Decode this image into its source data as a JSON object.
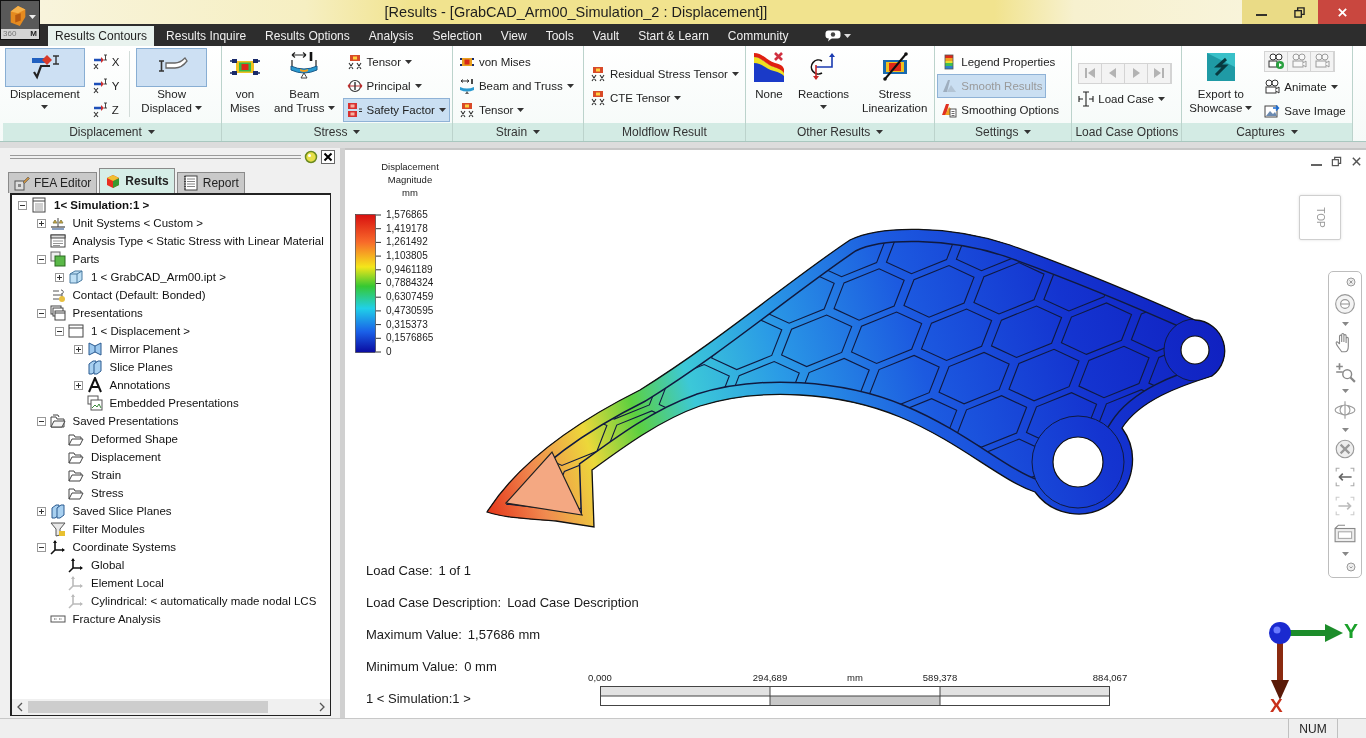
{
  "app_button": {
    "badge": "360",
    "letter": "M"
  },
  "window": {
    "title": "[Results - [GrabCAD_Arm00_Simulation_2 : Displacement]]"
  },
  "ribbon_tabs": [
    {
      "label": "Results Contours",
      "selected": true
    },
    {
      "label": "Results Inquire",
      "selected": false
    },
    {
      "label": "Results Options",
      "selected": false
    },
    {
      "label": "Analysis",
      "selected": false
    },
    {
      "label": "Selection",
      "selected": false
    },
    {
      "label": "View",
      "selected": false
    },
    {
      "label": "Tools",
      "selected": false
    },
    {
      "label": "Vault",
      "selected": false
    },
    {
      "label": "Start & Learn",
      "selected": false
    },
    {
      "label": "Community",
      "selected": false
    }
  ],
  "ribbon_groups": [
    {
      "label": "Displacement",
      "menu": true,
      "columns": [
        {
          "kind": "large",
          "items": [
            {
              "kind": "displacement",
              "lines": [
                "Displacement"
              ],
              "dropdown": true,
              "selected": true,
              "disabled": false
            }
          ]
        },
        {
          "kind": "small",
          "items": [
            {
              "kind": "axis",
              "label": "X",
              "dropdown": false,
              "selected": false,
              "disabled": false
            },
            {
              "kind": "axis",
              "label": "Y",
              "dropdown": false,
              "selected": false,
              "disabled": false
            },
            {
              "kind": "axis",
              "label": "Z",
              "dropdown": false,
              "selected": false,
              "disabled": false
            }
          ]
        },
        {
          "kind": "large",
          "items": [
            {
              "kind": "show_displaced",
              "lines": [
                "Show",
                "Displaced"
              ],
              "dropdown": true,
              "selected": true,
              "disabled": false
            }
          ]
        }
      ]
    },
    {
      "label": "Stress",
      "menu": true,
      "columns": [
        {
          "kind": "large",
          "items": [
            {
              "kind": "stress_block",
              "lines": [
                "von",
                "Mises"
              ],
              "dropdown": false,
              "selected": false,
              "disabled": false
            }
          ]
        },
        {
          "kind": "large",
          "items": [
            {
              "kind": "beam",
              "lines": [
                "Beam",
                "and Truss"
              ],
              "dropdown": true,
              "selected": false,
              "disabled": false
            }
          ]
        },
        {
          "kind": "small",
          "items": [
            {
              "kind": "tensor",
              "label": "Tensor",
              "dropdown": true,
              "selected": false,
              "disabled": false
            },
            {
              "kind": "principal",
              "label": "Principal",
              "dropdown": true,
              "selected": false,
              "disabled": false
            },
            {
              "kind": "safety",
              "label": "Safety Factor",
              "dropdown": true,
              "selected": true,
              "disabled": false
            }
          ]
        }
      ]
    },
    {
      "label": "Strain",
      "menu": true,
      "columns": [
        {
          "kind": "small",
          "items": [
            {
              "kind": "stress_small",
              "label": "von Mises",
              "dropdown": false,
              "selected": false,
              "disabled": false
            },
            {
              "kind": "beam_small",
              "label": "Beam and Truss",
              "dropdown": true,
              "selected": false,
              "disabled": false
            },
            {
              "kind": "tensor",
              "label": "Tensor",
              "dropdown": true,
              "selected": false,
              "disabled": false
            }
          ]
        }
      ]
    },
    {
      "label": "Moldflow Result",
      "menu": false,
      "columns": [
        {
          "kind": "small",
          "items": [
            {
              "kind": "tensor",
              "label": "Residual Stress Tensor",
              "dropdown": true,
              "selected": false,
              "disabled": false
            },
            {
              "kind": "tensor",
              "label": "CTE Tensor",
              "dropdown": true,
              "selected": false,
              "disabled": false
            }
          ]
        }
      ]
    },
    {
      "label": "Other Results",
      "menu": true,
      "columns": [
        {
          "kind": "large",
          "items": [
            {
              "kind": "contour_none",
              "lines": [
                "None"
              ],
              "dropdown": false,
              "selected": false,
              "disabled": false
            }
          ]
        },
        {
          "kind": "large",
          "items": [
            {
              "kind": "reactions",
              "lines": [
                "Reactions"
              ],
              "dropdown": true,
              "selected": false,
              "disabled": false
            }
          ]
        },
        {
          "kind": "large",
          "items": [
            {
              "kind": "linearization",
              "lines": [
                "Stress",
                "Linearization"
              ],
              "dropdown": false,
              "selected": false,
              "disabled": false
            }
          ]
        }
      ]
    },
    {
      "label": "Settings",
      "menu": true,
      "columns": [
        {
          "kind": "small",
          "items": [
            {
              "kind": "legend",
              "label": "Legend Properties",
              "dropdown": false,
              "selected": false,
              "disabled": false
            },
            {
              "kind": "smooth",
              "label": "Smooth Results",
              "dropdown": false,
              "selected": true,
              "disabled": true
            },
            {
              "kind": "smoothing",
              "label": "Smoothing Options",
              "dropdown": false,
              "selected": false,
              "disabled": false
            }
          ]
        }
      ]
    },
    {
      "label": "Load Case Options",
      "menu": false,
      "columns": [
        {
          "kind": "small",
          "items": [
            {
              "kind": "first",
              "selected": false,
              "disabled": true
            },
            {
              "kind": "previous",
              "selected": false,
              "disabled": true
            },
            {
              "kind": "next",
              "selected": false,
              "disabled": true
            },
            {
              "kind": "last",
              "selected": false,
              "disabled": true
            },
            {
              "kind": "load_case",
              "label": "Load Case",
              "dropdown": true,
              "selected": false,
              "disabled": false
            }
          ]
        }
      ]
    },
    {
      "label": "Captures",
      "menu": true,
      "columns": [
        {
          "kind": "large",
          "items": [
            {
              "kind": "showcase",
              "lines": [
                "Export to",
                "Showcase"
              ],
              "dropdown": true,
              "selected": false,
              "disabled": false
            }
          ]
        },
        {
          "kind": "small",
          "items": [
            {
              "kind": "animate_play",
              "selected": false,
              "disabled": false
            },
            {
              "kind": "animate_record",
              "selected": false,
              "disabled": true
            },
            {
              "kind": "animate_stop",
              "selected": false,
              "disabled": true
            },
            {
              "kind": "animate",
              "label": "Animate",
              "dropdown": true,
              "selected": false,
              "disabled": false
            },
            {
              "kind": "save_image",
              "label": "Save Image",
              "dropdown": false,
              "selected": false,
              "disabled": false
            }
          ]
        }
      ]
    }
  ],
  "left_panel": {
    "tabs": [
      {
        "label": "FEA Editor",
        "selected": false
      },
      {
        "label": "Results",
        "selected": true
      },
      {
        "label": "Report",
        "selected": false
      }
    ],
    "tree": [
      {
        "label": "1< Simulation:1 >",
        "kind": "simulation",
        "expanded": true,
        "children": [
          {
            "label": "Unit Systems < Custom >",
            "kind": "units",
            "expanded": false
          },
          {
            "label": "Analysis Type < Static Stress with Linear Material",
            "kind": "analysis"
          },
          {
            "label": "Parts",
            "kind": "parts",
            "expanded": true,
            "children": [
              {
                "label": "1 < GrabCAD_Arm00.ipt >",
                "kind": "part",
                "expanded": false
              }
            ]
          },
          {
            "label": "Contact (Default: Bonded)",
            "kind": "contact"
          },
          {
            "label": "Presentations",
            "kind": "presentations",
            "expanded": true,
            "children": [
              {
                "label": "1 < Displacement >",
                "kind": "presentation",
                "expanded": true,
                "children": [
                  {
                    "label": "Mirror Planes",
                    "kind": "mirror",
                    "expanded": false
                  },
                  {
                    "label": "Slice Planes",
                    "kind": "slice"
                  },
                  {
                    "label": "Annotations",
                    "kind": "annotation",
                    "expanded": false
                  },
                  {
                    "label": "Embedded Presentations",
                    "kind": "embedded"
                  }
                ]
              }
            ]
          },
          {
            "label": "Saved Presentations",
            "kind": "saved",
            "expanded": true,
            "children": [
              {
                "label": "Deformed Shape",
                "kind": "saved_item"
              },
              {
                "label": "Displacement",
                "kind": "saved_item"
              },
              {
                "label": "Strain",
                "kind": "saved_item"
              },
              {
                "label": "Stress",
                "kind": "saved_item"
              }
            ]
          },
          {
            "label": "Saved Slice Planes",
            "kind": "slice",
            "expanded": false
          },
          {
            "label": "Filter Modules",
            "kind": "filter"
          },
          {
            "label": "Coordinate Systems",
            "kind": "axes",
            "expanded": true,
            "children": [
              {
                "label": "Global",
                "kind": "axes"
              },
              {
                "label": "Element Local",
                "kind": "local_axes"
              },
              {
                "label": "Cylindrical: < automatically made nodal LCS",
                "kind": "local_axes"
              }
            ]
          },
          {
            "label": "Fracture Analysis",
            "kind": "fracture"
          }
        ]
      }
    ]
  },
  "viewport": {
    "legend": {
      "title_lines": [
        "Displacement",
        "Magnitude",
        "mm"
      ],
      "values": [
        "1,576865",
        "1,419178",
        "1,261492",
        "1,103805",
        "0,9461189",
        "0,7884324",
        "0,6307459",
        "0,4730595",
        "0,315373",
        "0,1576865",
        "0"
      ]
    },
    "info": [
      {
        "label": "Load Case:",
        "value": "1 of 1"
      },
      {
        "label": "Load Case Description:",
        "value": "Load Case Description"
      },
      {
        "label": "Maximum Value:",
        "value": "1,57686 mm"
      },
      {
        "label": "Minimum Value:",
        "value": "0 mm"
      }
    ],
    "result_name": "1 < Simulation:1 >",
    "scale_bar": {
      "ticks": [
        "0,000",
        "294,689",
        "589,378",
        "884,067"
      ],
      "unit": "mm"
    },
    "view_cube": {
      "face": "TOP"
    },
    "axis_triad": {
      "horizontal": "Y",
      "vertical": "X"
    }
  },
  "status_bar": {
    "cells": [
      "NUM"
    ]
  }
}
